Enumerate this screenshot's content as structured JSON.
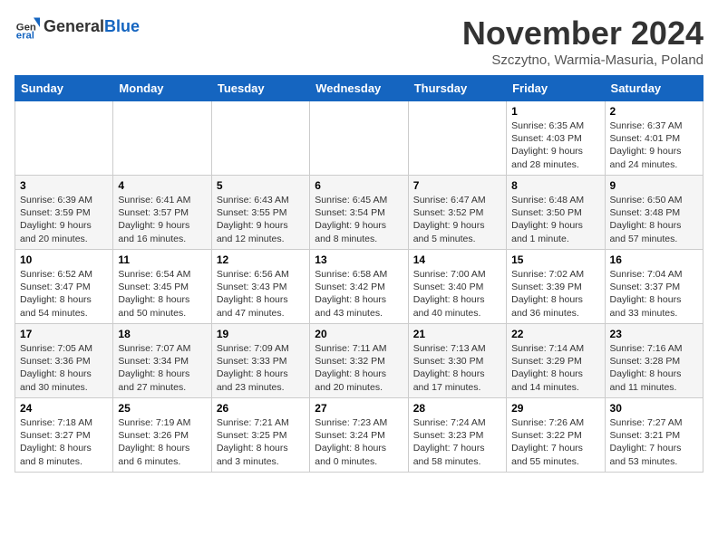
{
  "header": {
    "logo_general": "General",
    "logo_blue": "Blue",
    "month_title": "November 2024",
    "subtitle": "Szczytno, Warmia-Masuria, Poland"
  },
  "weekdays": [
    "Sunday",
    "Monday",
    "Tuesday",
    "Wednesday",
    "Thursday",
    "Friday",
    "Saturday"
  ],
  "weeks": [
    [
      {
        "day": "",
        "info": ""
      },
      {
        "day": "",
        "info": ""
      },
      {
        "day": "",
        "info": ""
      },
      {
        "day": "",
        "info": ""
      },
      {
        "day": "",
        "info": ""
      },
      {
        "day": "1",
        "info": "Sunrise: 6:35 AM\nSunset: 4:03 PM\nDaylight: 9 hours and 28 minutes."
      },
      {
        "day": "2",
        "info": "Sunrise: 6:37 AM\nSunset: 4:01 PM\nDaylight: 9 hours and 24 minutes."
      }
    ],
    [
      {
        "day": "3",
        "info": "Sunrise: 6:39 AM\nSunset: 3:59 PM\nDaylight: 9 hours and 20 minutes."
      },
      {
        "day": "4",
        "info": "Sunrise: 6:41 AM\nSunset: 3:57 PM\nDaylight: 9 hours and 16 minutes."
      },
      {
        "day": "5",
        "info": "Sunrise: 6:43 AM\nSunset: 3:55 PM\nDaylight: 9 hours and 12 minutes."
      },
      {
        "day": "6",
        "info": "Sunrise: 6:45 AM\nSunset: 3:54 PM\nDaylight: 9 hours and 8 minutes."
      },
      {
        "day": "7",
        "info": "Sunrise: 6:47 AM\nSunset: 3:52 PM\nDaylight: 9 hours and 5 minutes."
      },
      {
        "day": "8",
        "info": "Sunrise: 6:48 AM\nSunset: 3:50 PM\nDaylight: 9 hours and 1 minute."
      },
      {
        "day": "9",
        "info": "Sunrise: 6:50 AM\nSunset: 3:48 PM\nDaylight: 8 hours and 57 minutes."
      }
    ],
    [
      {
        "day": "10",
        "info": "Sunrise: 6:52 AM\nSunset: 3:47 PM\nDaylight: 8 hours and 54 minutes."
      },
      {
        "day": "11",
        "info": "Sunrise: 6:54 AM\nSunset: 3:45 PM\nDaylight: 8 hours and 50 minutes."
      },
      {
        "day": "12",
        "info": "Sunrise: 6:56 AM\nSunset: 3:43 PM\nDaylight: 8 hours and 47 minutes."
      },
      {
        "day": "13",
        "info": "Sunrise: 6:58 AM\nSunset: 3:42 PM\nDaylight: 8 hours and 43 minutes."
      },
      {
        "day": "14",
        "info": "Sunrise: 7:00 AM\nSunset: 3:40 PM\nDaylight: 8 hours and 40 minutes."
      },
      {
        "day": "15",
        "info": "Sunrise: 7:02 AM\nSunset: 3:39 PM\nDaylight: 8 hours and 36 minutes."
      },
      {
        "day": "16",
        "info": "Sunrise: 7:04 AM\nSunset: 3:37 PM\nDaylight: 8 hours and 33 minutes."
      }
    ],
    [
      {
        "day": "17",
        "info": "Sunrise: 7:05 AM\nSunset: 3:36 PM\nDaylight: 8 hours and 30 minutes."
      },
      {
        "day": "18",
        "info": "Sunrise: 7:07 AM\nSunset: 3:34 PM\nDaylight: 8 hours and 27 minutes."
      },
      {
        "day": "19",
        "info": "Sunrise: 7:09 AM\nSunset: 3:33 PM\nDaylight: 8 hours and 23 minutes."
      },
      {
        "day": "20",
        "info": "Sunrise: 7:11 AM\nSunset: 3:32 PM\nDaylight: 8 hours and 20 minutes."
      },
      {
        "day": "21",
        "info": "Sunrise: 7:13 AM\nSunset: 3:30 PM\nDaylight: 8 hours and 17 minutes."
      },
      {
        "day": "22",
        "info": "Sunrise: 7:14 AM\nSunset: 3:29 PM\nDaylight: 8 hours and 14 minutes."
      },
      {
        "day": "23",
        "info": "Sunrise: 7:16 AM\nSunset: 3:28 PM\nDaylight: 8 hours and 11 minutes."
      }
    ],
    [
      {
        "day": "24",
        "info": "Sunrise: 7:18 AM\nSunset: 3:27 PM\nDaylight: 8 hours and 8 minutes."
      },
      {
        "day": "25",
        "info": "Sunrise: 7:19 AM\nSunset: 3:26 PM\nDaylight: 8 hours and 6 minutes."
      },
      {
        "day": "26",
        "info": "Sunrise: 7:21 AM\nSunset: 3:25 PM\nDaylight: 8 hours and 3 minutes."
      },
      {
        "day": "27",
        "info": "Sunrise: 7:23 AM\nSunset: 3:24 PM\nDaylight: 8 hours and 0 minutes."
      },
      {
        "day": "28",
        "info": "Sunrise: 7:24 AM\nSunset: 3:23 PM\nDaylight: 7 hours and 58 minutes."
      },
      {
        "day": "29",
        "info": "Sunrise: 7:26 AM\nSunset: 3:22 PM\nDaylight: 7 hours and 55 minutes."
      },
      {
        "day": "30",
        "info": "Sunrise: 7:27 AM\nSunset: 3:21 PM\nDaylight: 7 hours and 53 minutes."
      }
    ]
  ]
}
